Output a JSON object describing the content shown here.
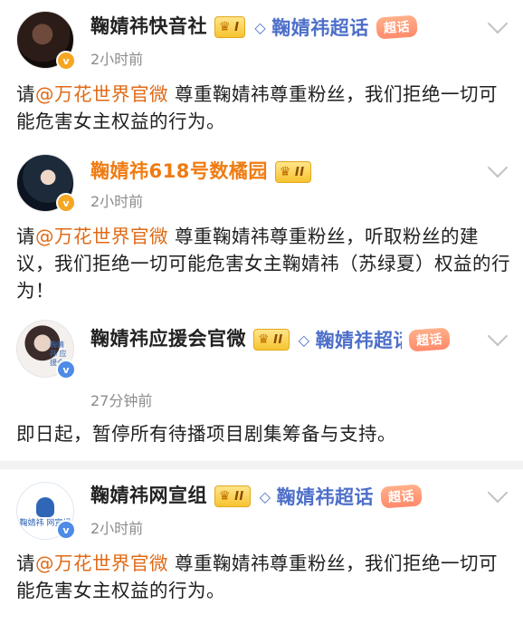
{
  "posts": [
    {
      "username": "鞠婧祎快音社",
      "level": "I",
      "supertopic": "鞠婧祎超话",
      "supertopic_tag": "超话",
      "time": "2小时前",
      "content_prefix": "请",
      "mention": "@万花世界官微",
      "content_rest": " 尊重鞠婧祎尊重粉丝，我们拒绝一切可能危害女主权益的行为。"
    },
    {
      "username": "鞠婧祎618号数橘园",
      "level": "II",
      "time": "2小时前",
      "content_prefix": "请",
      "mention": "@万花世界官微",
      "content_rest": " 尊重鞠婧祎尊重粉丝，听取粉丝的建议，我们拒绝一切可能危害女主鞠婧祎（苏绿夏）权益的行为！"
    },
    {
      "username": "鞠婧祎应援会官微",
      "level": "II",
      "supertopic": "鞠婧祎超话",
      "supertopic_tag": "超话",
      "time": "27分钟前",
      "content": "即日起，暂停所有待播项目剧集筹备与支持。",
      "avatar_text": "鞠婧祎 应援会"
    },
    {
      "username": "鞠婧祎网宣组",
      "level": "II",
      "supertopic": "鞠婧祎超话",
      "supertopic_tag": "超话",
      "time": "2小时前",
      "content_prefix": "请",
      "mention": "@万花世界官微",
      "content_rest": " 尊重鞠婧祎尊重粉丝，我们拒绝一切可能危害女主权益的行为。",
      "avatar_text": "鞠婧祎 网宣组"
    }
  ],
  "icons": {
    "verified": "v-verified-icon",
    "crown": "crown-icon",
    "diamond": "diamond-icon",
    "chevron": "chevron-down-icon"
  },
  "colors": {
    "mention": "#e06a16",
    "supertopic": "#4d6fc9",
    "orange_name": "#f07b11",
    "time": "#8c8c8c"
  }
}
